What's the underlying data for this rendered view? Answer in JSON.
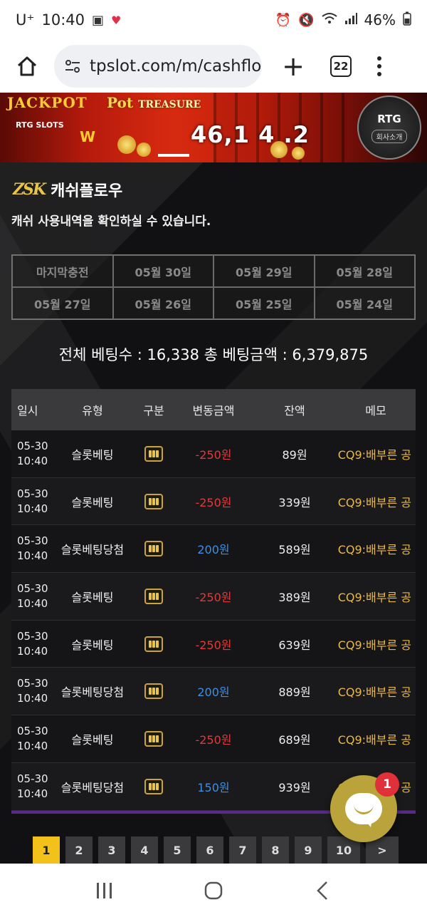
{
  "status_bar": {
    "carrier": "U⁺",
    "time": "10:40",
    "battery": "46%"
  },
  "browser": {
    "url": "tpslot.com/m/cashflo",
    "tab_count": "22"
  },
  "banner": {
    "jackpot_label": "JACKPOT",
    "rtg_label": "RTG SLOTS",
    "game_title": "Pot",
    "game_title_sub": "TREASURE",
    "jackpot_amount": "46,1 4 .2",
    "badge_title": "RTG",
    "badge_sub": "회사소개"
  },
  "page": {
    "logo": "ZSK",
    "title": "캐쉬플로우",
    "description": "캐쉬 사용내역을 확인하실 수 있습니다."
  },
  "dates": [
    "마지막충전",
    "05월 30일",
    "05월 29일",
    "05월 28일",
    "05월 27일",
    "05월 26일",
    "05월 25일",
    "05월 24일"
  ],
  "summary": {
    "text": "전체 베팅수 : 16,338   총 베팅금액 : 6,379,875"
  },
  "table": {
    "headers": {
      "time": "일시",
      "type": "유형",
      "kind": "구분",
      "amount": "변동금액",
      "balance": "잔액",
      "memo": "메모"
    },
    "rows": [
      {
        "date": "05-30",
        "time": "10:40",
        "type": "슬롯베팅",
        "amount": "-250원",
        "balance": "89원",
        "memo": "CQ9:배부른 공"
      },
      {
        "date": "05-30",
        "time": "10:40",
        "type": "슬롯베팅",
        "amount": "-250원",
        "balance": "339원",
        "memo": "CQ9:배부른 공"
      },
      {
        "date": "05-30",
        "time": "10:40",
        "type": "슬롯베팅당첨",
        "amount": "200원",
        "balance": "589원",
        "memo": "CQ9:배부른 공"
      },
      {
        "date": "05-30",
        "time": "10:40",
        "type": "슬롯베팅",
        "amount": "-250원",
        "balance": "389원",
        "memo": "CQ9:배부른 공"
      },
      {
        "date": "05-30",
        "time": "10:40",
        "type": "슬롯베팅",
        "amount": "-250원",
        "balance": "639원",
        "memo": "CQ9:배부른 공"
      },
      {
        "date": "05-30",
        "time": "10:40",
        "type": "슬롯베팅당첨",
        "amount": "200원",
        "balance": "889원",
        "memo": "CQ9:배부른 공"
      },
      {
        "date": "05-30",
        "time": "10:40",
        "type": "슬롯베팅",
        "amount": "-250원",
        "balance": "689원",
        "memo": "CQ9:배부른 공"
      },
      {
        "date": "05-30",
        "time": "10:40",
        "type": "슬롯베팅당첨",
        "amount": "150원",
        "balance": "939원",
        "memo": "CQ9:배부른 공"
      }
    ]
  },
  "pagination": {
    "pages": [
      "1",
      "2",
      "3",
      "4",
      "5",
      "6",
      "7",
      "8",
      "9",
      "10"
    ],
    "active": "1",
    "next": ">"
  },
  "chat": {
    "badge_count": "1"
  },
  "colors": {
    "accent": "#f2c21b",
    "negative": "#e03a3a",
    "positive": "#3b8fe8",
    "memo": "#e8b94a"
  }
}
